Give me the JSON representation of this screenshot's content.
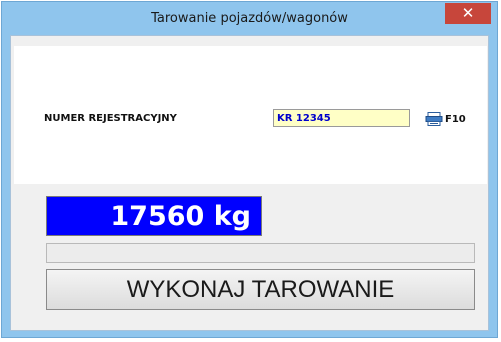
{
  "window": {
    "title": "Tarowanie pojazdów/wagonów",
    "close_glyph": "✕",
    "accent_color": "#8fc5ed",
    "close_color": "#c7463b"
  },
  "form": {
    "plate_label": "NUMER REJESTRACYJNY",
    "plate_value": "KR 12345",
    "plate_field_color": "#ffffc6",
    "scan_icon": "keyboard-icon",
    "scan_label": "F10"
  },
  "weight": {
    "value": "17560 kg",
    "background_color": "#0000ff"
  },
  "status": {
    "text": ""
  },
  "actions": {
    "tare_label": "WYKONAJ TAROWANIE"
  }
}
